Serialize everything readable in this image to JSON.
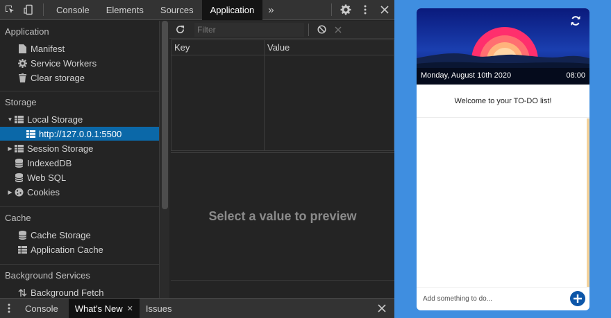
{
  "devtools": {
    "tabs": [
      {
        "label": "Console"
      },
      {
        "label": "Elements"
      },
      {
        "label": "Sources"
      },
      {
        "label": "Application"
      }
    ],
    "more_tabs": "»",
    "sidebar": {
      "application": {
        "header": "Application",
        "items": [
          {
            "label": "Manifest",
            "icon": "file-icon"
          },
          {
            "label": "Service Workers",
            "icon": "gear-icon"
          },
          {
            "label": "Clear storage",
            "icon": "trash-icon"
          }
        ]
      },
      "storage": {
        "header": "Storage",
        "local_storage": "Local Storage",
        "local_origin": "http://127.0.0.1:5500",
        "session_storage": "Session Storage",
        "indexeddb": "IndexedDB",
        "web_sql": "Web SQL",
        "cookies": "Cookies"
      },
      "cache": {
        "header": "Cache",
        "cache_storage": "Cache Storage",
        "app_cache": "Application Cache"
      },
      "background": {
        "header": "Background Services",
        "fetch": "Background Fetch"
      }
    },
    "filter_placeholder": "Filter",
    "table": {
      "key_header": "Key",
      "value_header": "Value"
    },
    "preview_text": "Select a value to preview",
    "drawer": {
      "tabs": [
        {
          "label": "Console"
        },
        {
          "label": "What's New"
        },
        {
          "label": "Issues"
        }
      ]
    }
  },
  "app": {
    "date": "Monday, August 10th 2020",
    "time": "08:00",
    "welcome": "Welcome to your TO-DO list!",
    "input_placeholder": "Add something to do...",
    "colors": {
      "accent": "#0d56a8",
      "background": "#3f8ee0",
      "list_bar": "#f3d29b"
    }
  }
}
